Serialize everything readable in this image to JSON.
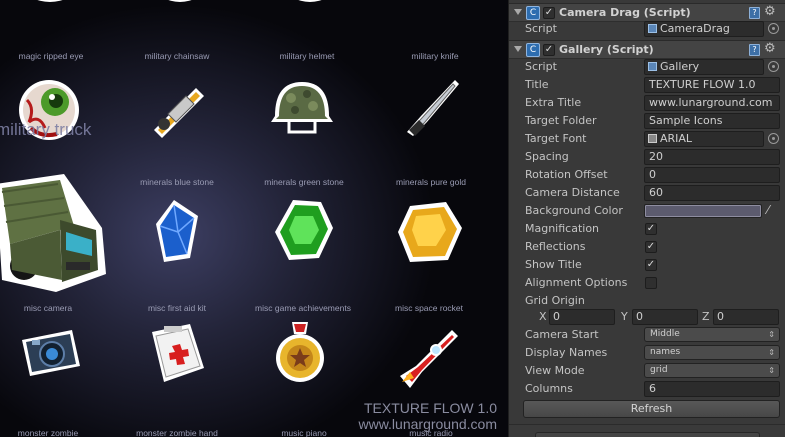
{
  "gallery": {
    "top_captions": [
      "magic ripped eye",
      "military chainsaw",
      "military helmet",
      "military knife"
    ],
    "overlay_title": "military truck",
    "mid_captions": [
      "minerals blue stone",
      "minerals green stone",
      "minerals pure gold"
    ],
    "row3_captions": [
      "misc camera",
      "misc first aid kit",
      "misc game achievements",
      "misc space rocket"
    ],
    "bottom_captions": [
      "monster zombie",
      "monster zombie hand",
      "music piano",
      "music radio"
    ],
    "watermark_title": "TEXTURE FLOW 1.0",
    "watermark_url": "www.lunarground.com"
  },
  "inspector": {
    "camera_drag": {
      "header": "Camera Drag (Script)",
      "script_label": "Script",
      "script_value": "CameraDrag"
    },
    "gallery_comp": {
      "header": "Gallery (Script)",
      "fields": {
        "script": {
          "label": "Script",
          "value": "Gallery"
        },
        "title": {
          "label": "Title",
          "value": "TEXTURE FLOW 1.0"
        },
        "extra_title": {
          "label": "Extra Title",
          "value": "www.lunarground.com"
        },
        "target_folder": {
          "label": "Target Folder",
          "value": "Sample Icons"
        },
        "target_font": {
          "label": "Target Font",
          "value": "ARIAL"
        },
        "spacing": {
          "label": "Spacing",
          "value": "20"
        },
        "rotation_offset": {
          "label": "Rotation Offset",
          "value": "0"
        },
        "camera_distance": {
          "label": "Camera Distance",
          "value": "60"
        },
        "background_color": {
          "label": "Background Color",
          "value": "#5c5b6e"
        },
        "magnification": {
          "label": "Magnification",
          "checked": true
        },
        "reflections": {
          "label": "Reflections",
          "checked": true
        },
        "show_title": {
          "label": "Show Title",
          "checked": true
        },
        "alignment_options": {
          "label": "Alignment Options",
          "checked": false
        },
        "grid_origin": {
          "label": "Grid Origin",
          "x_label": "X",
          "x": "0",
          "y_label": "Y",
          "y": "0",
          "z_label": "Z",
          "z": "0"
        },
        "camera_start": {
          "label": "Camera Start",
          "value": "Middle"
        },
        "display_names": {
          "label": "Display Names",
          "value": "names"
        },
        "view_mode": {
          "label": "View Mode",
          "value": "grid"
        },
        "columns": {
          "label": "Columns",
          "value": "6"
        }
      },
      "refresh_label": "Refresh"
    }
  },
  "colors": {
    "inspector_bg": "#393939",
    "field_bg": "#2c2c2c",
    "script_blue": "#2d6db0",
    "background_swatch": "#5c5b6e"
  }
}
